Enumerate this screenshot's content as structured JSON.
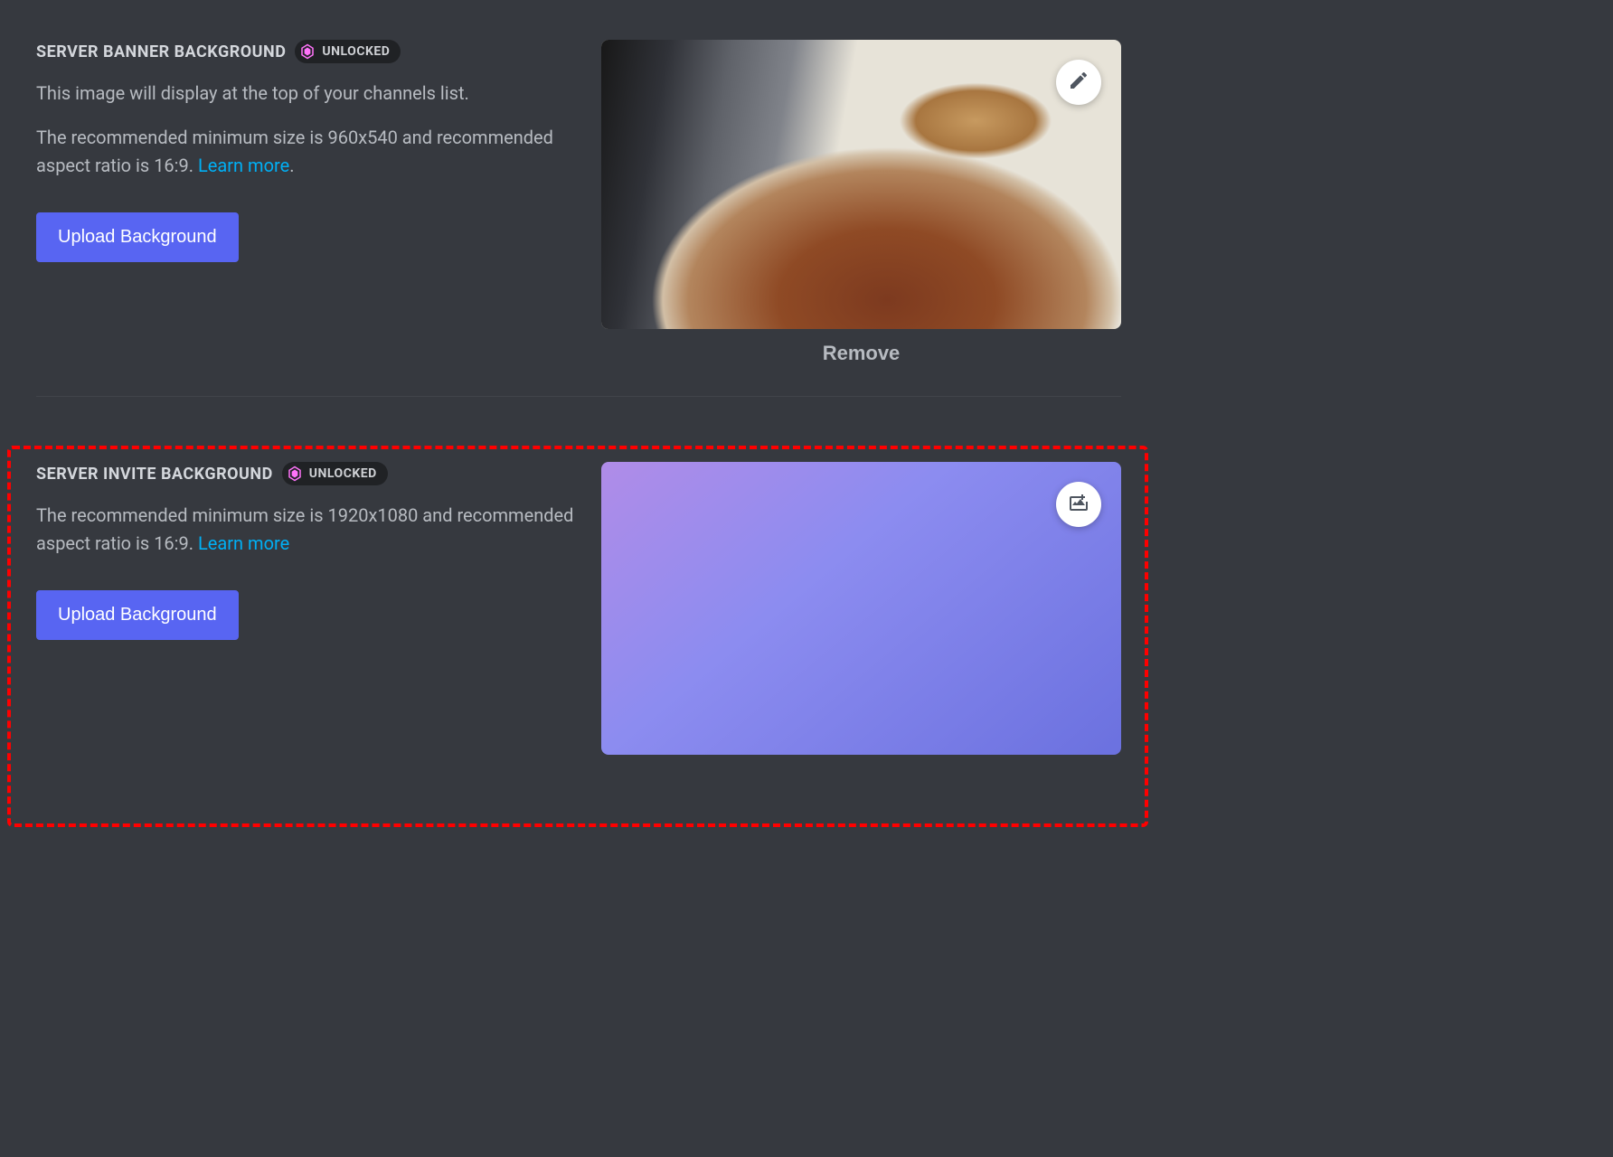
{
  "banner": {
    "title": "SERVER BANNER BACKGROUND",
    "badge": "UNLOCKED",
    "desc1": "This image will display at the top of your channels list.",
    "desc2_pre": "The recommended minimum size is 960x540 and recommended aspect ratio is 16:9. ",
    "learn_more": "Learn more",
    "desc2_post": ".",
    "upload_button": "Upload Background",
    "remove_button": "Remove"
  },
  "invite": {
    "title": "SERVER INVITE BACKGROUND",
    "badge": "UNLOCKED",
    "desc_pre": "The recommended minimum size is 1920x1080 and recommended aspect ratio is 16:9. ",
    "learn_more": "Learn more",
    "upload_button": "Upload Background"
  },
  "colors": {
    "accent": "#5865f2",
    "link": "#00aff4",
    "highlight": "#ff0000"
  }
}
